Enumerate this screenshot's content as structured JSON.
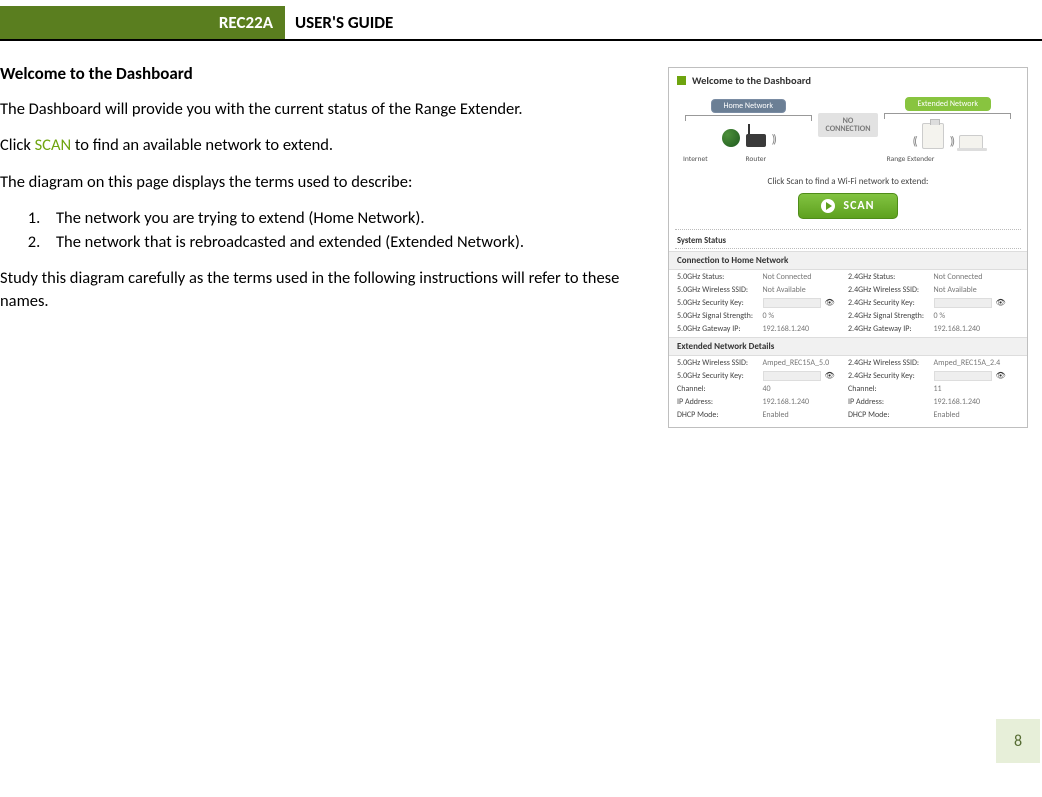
{
  "header": {
    "product": "REC22A",
    "title": "USER'S GUIDE"
  },
  "main": {
    "heading": "Welcome to the Dashboard",
    "p1": "The Dashboard will provide you with the current status of the Range Extender.",
    "p2a": "Click ",
    "p2scan": "SCAN",
    "p2b": " to find an available network to extend.",
    "p3": "The diagram on this page displays the terms used to describe:",
    "li1": "The network you are trying to extend (Home Network).",
    "li2": "The network that is rebroadcasted and extended (Extended Network).",
    "p4": "Study this diagram carefully as the terms used in the following instructions will refer to these names."
  },
  "figure": {
    "title": "Welcome to the Dashboard",
    "homeLabel": "Home Network",
    "extLabel": "Extended Network",
    "noconn1": "NO",
    "noconn2": "CONNECTION",
    "capInternet": "Internet",
    "capRouter": "Router",
    "capRE": "Range Extender",
    "scanCaption": "Click Scan to find a Wi-Fi network to extend:",
    "scanLabel": "SCAN",
    "sysStatus": "System Status",
    "connHead": "Connection to Home Network",
    "extHead": "Extended Network Details",
    "home5": {
      "statusL": "5.0GHz Status:",
      "statusV": "Not Connected",
      "ssidL": "5.0GHz Wireless SSID:",
      "ssidV": "Not Available",
      "keyL": "5.0GHz Security Key:",
      "sigL": "5.0GHz Signal Strength:",
      "sigV": "0 %",
      "gwL": "5.0GHz Gateway IP:",
      "gwV": "192.168.1.240"
    },
    "home24": {
      "statusL": "2.4GHz Status:",
      "statusV": "Not Connected",
      "ssidL": "2.4GHz Wireless SSID:",
      "ssidV": "Not Available",
      "keyL": "2.4GHz Security Key:",
      "sigL": "2.4GHz Signal Strength:",
      "sigV": "0 %",
      "gwL": "2.4GHz Gateway IP:",
      "gwV": "192.168.1.240"
    },
    "ext5": {
      "ssidL": "5.0GHz Wireless SSID:",
      "ssidV": "Amped_REC15A_5.0",
      "keyL": "5.0GHz Security Key:",
      "chL": "Channel:",
      "chV": "40",
      "ipL": "IP Address:",
      "ipV": "192.168.1.240",
      "dhcpL": "DHCP Mode:",
      "dhcpV": "Enabled"
    },
    "ext24": {
      "ssidL": "2.4GHz Wireless SSID:",
      "ssidV": "Amped_REC15A_2.4",
      "keyL": "2.4GHz Security Key:",
      "chL": "Channel:",
      "chV": "11",
      "ipL": "IP Address:",
      "ipV": "192.168.1.240",
      "dhcpL": "DHCP Mode:",
      "dhcpV": "Enabled"
    }
  },
  "pageNumber": "8"
}
